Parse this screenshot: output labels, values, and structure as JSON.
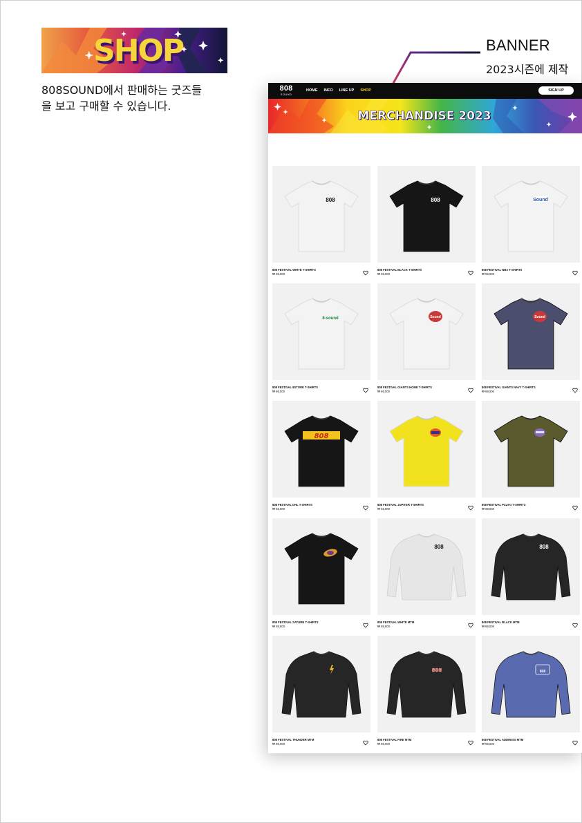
{
  "shop_section": {
    "badge_text": "SHOP",
    "description_line1": "808SOUND에서 판매하는 굿즈들",
    "description_line2": "을 보고 구매할 수 있습니다."
  },
  "annotation": {
    "title": "BANNER",
    "subtitle": "2023시즌에 제작"
  },
  "mockup": {
    "logo": {
      "number": "808",
      "sub": "SOUND"
    },
    "nav": [
      "HOME",
      "INFO",
      "LINE UP",
      "SHOP"
    ],
    "active_nav": "SHOP",
    "signup_label": "SIGN UP",
    "banner_title": "MERCHANDISE 2023",
    "products": [
      {
        "name": "808 FESTIVAL WHITE T-SHIRTS",
        "price": "₩ 69,000",
        "kind": "tee",
        "color": "#f3f3f3",
        "print": "808"
      },
      {
        "name": "808 FESTIVAL BLACK T-SHIRTS",
        "price": "₩ 69,000",
        "kind": "tee",
        "color": "#161616",
        "print": "808"
      },
      {
        "name": "808 FESTIVAL NBA T-SHIRTS",
        "price": "₩ 69,000",
        "kind": "tee",
        "color": "#f3f3f3",
        "print": "Sound"
      },
      {
        "name": "808 FESTIVAL 8STORE T-SHIRTS",
        "price": "₩ 69,000",
        "kind": "tee",
        "color": "#f3f3f3",
        "print": "8-sound"
      },
      {
        "name": "808 FESTIVAL GIANTS HOME T-SHIRTS",
        "price": "₩ 69,000",
        "kind": "tee",
        "color": "#f3f3f3",
        "print": "Sound"
      },
      {
        "name": "808 FESTIVAL GIANTS NAVY T-SHIRTS",
        "price": "₩ 69,000",
        "kind": "tee",
        "color": "#4b4e6c",
        "print": "Sound"
      },
      {
        "name": "808 FESTIVAL DHL T-SHIRTS",
        "price": "₩ 69,000",
        "kind": "tee",
        "color": "#161616",
        "print": "808"
      },
      {
        "name": "808 FESTIVAL JUPITER T-SHIRTS",
        "price": "₩ 69,000",
        "kind": "tee",
        "color": "#f2e21e",
        "print": ""
      },
      {
        "name": "808 FESTIVAL PLUTO T-SHIRTS",
        "price": "₩ 69,000",
        "kind": "tee",
        "color": "#5a5a2e",
        "print": ""
      },
      {
        "name": "808 FESTIVAL SATURN T-SHIRTS",
        "price": "₩ 69,000",
        "kind": "tee",
        "color": "#161616",
        "print": ""
      },
      {
        "name": "808 FESTIVAL WHITE MTM",
        "price": "₩ 89,000",
        "kind": "mtm",
        "color": "#e6e6e6",
        "print": "808"
      },
      {
        "name": "808 FESTIVAL BLACK MTM",
        "price": "₩ 89,000",
        "kind": "mtm",
        "color": "#262626",
        "print": "808"
      },
      {
        "name": "808 FESTIVAL THUNDER MTM",
        "price": "₩ 89,000",
        "kind": "mtm",
        "color": "#262626",
        "print": ""
      },
      {
        "name": "808 FESTIVAL FIRE MTM",
        "price": "₩ 89,000",
        "kind": "mtm",
        "color": "#262626",
        "print": "808"
      },
      {
        "name": "808 FESTIVAL ADDRESS MTM",
        "price": "₩ 89,000",
        "kind": "mtm",
        "color": "#5a6aae",
        "print": "808"
      }
    ]
  },
  "colors": {
    "accent_yellow": "#f2d22b",
    "nav_bg": "#0c0c0c",
    "shop_badge_purple": "#4b1f8f"
  }
}
